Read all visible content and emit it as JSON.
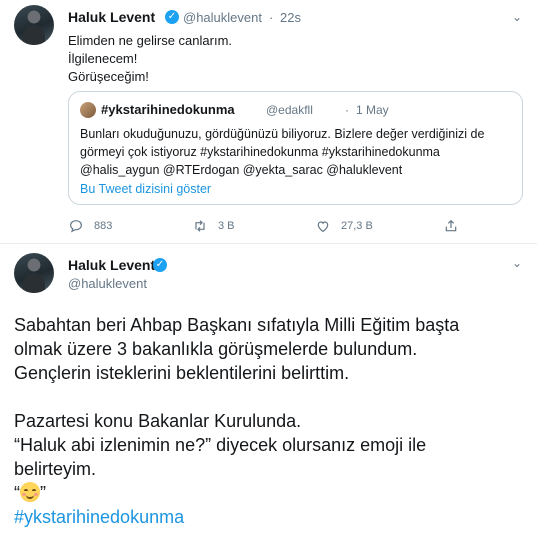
{
  "tweet1": {
    "author_name": "Haluk Levent",
    "author_handle": "@haluklevent",
    "separator": "·",
    "time": "22s",
    "lines": [
      "Elimden ne gelirse canlarım.",
      "İlgilenecem!",
      "Görüşeceğim!"
    ],
    "quote": {
      "author_name": "#ykstarihinedokunma",
      "author_handle": "@edakfll",
      "separator": "·",
      "date": "1 May",
      "lines": [
        "Bunları okuduğunuzu, gördüğünüzü biliyoruz. Bizlere değer verdiğinizi de",
        "görmeyi çok istiyoruz #ykstarihinedokunma #ykstarihinedokunma",
        "@halis_aygun @RTErdogan @yekta_sarac @haluklevent"
      ],
      "show_thread": "Bu Tweet dizisini göster"
    },
    "actions": {
      "reply_count": "883",
      "retweet_count": "3 B",
      "like_count": "27,3 B"
    }
  },
  "tweet2": {
    "author_name": "Haluk Levent",
    "author_handle": "@haluklevent",
    "lines": [
      "Sabahtan beri Ahbap Başkanı sıfatıyla Milli Eğitim başta",
      "olmak üzere 3 bakanlıkla görüşmelerde bulundum.",
      "Gençlerin isteklerini beklentilerini belirttim.",
      "",
      "Pazartesi konu Bakanlar Kurulunda.",
      "“Haluk abi izlenimin ne?” diyecek olursanız emoji ile",
      "belirteyim."
    ],
    "emoji_open_quote": "“",
    "emoji_close_quote": "”",
    "hashtag": "#ykstarihinedokunma"
  },
  "icons": {
    "verified": "verified-badge-icon",
    "chevron": "chevron-down-icon",
    "reply": "reply-icon",
    "retweet": "retweet-icon",
    "like": "heart-icon",
    "share": "share-icon",
    "emoji": "smiling-face-emoji"
  },
  "colors": {
    "accent": "#1da1f2",
    "link": "#1b95e0",
    "muted": "#657786",
    "text": "#14171a",
    "border": "#ccd6dd"
  }
}
